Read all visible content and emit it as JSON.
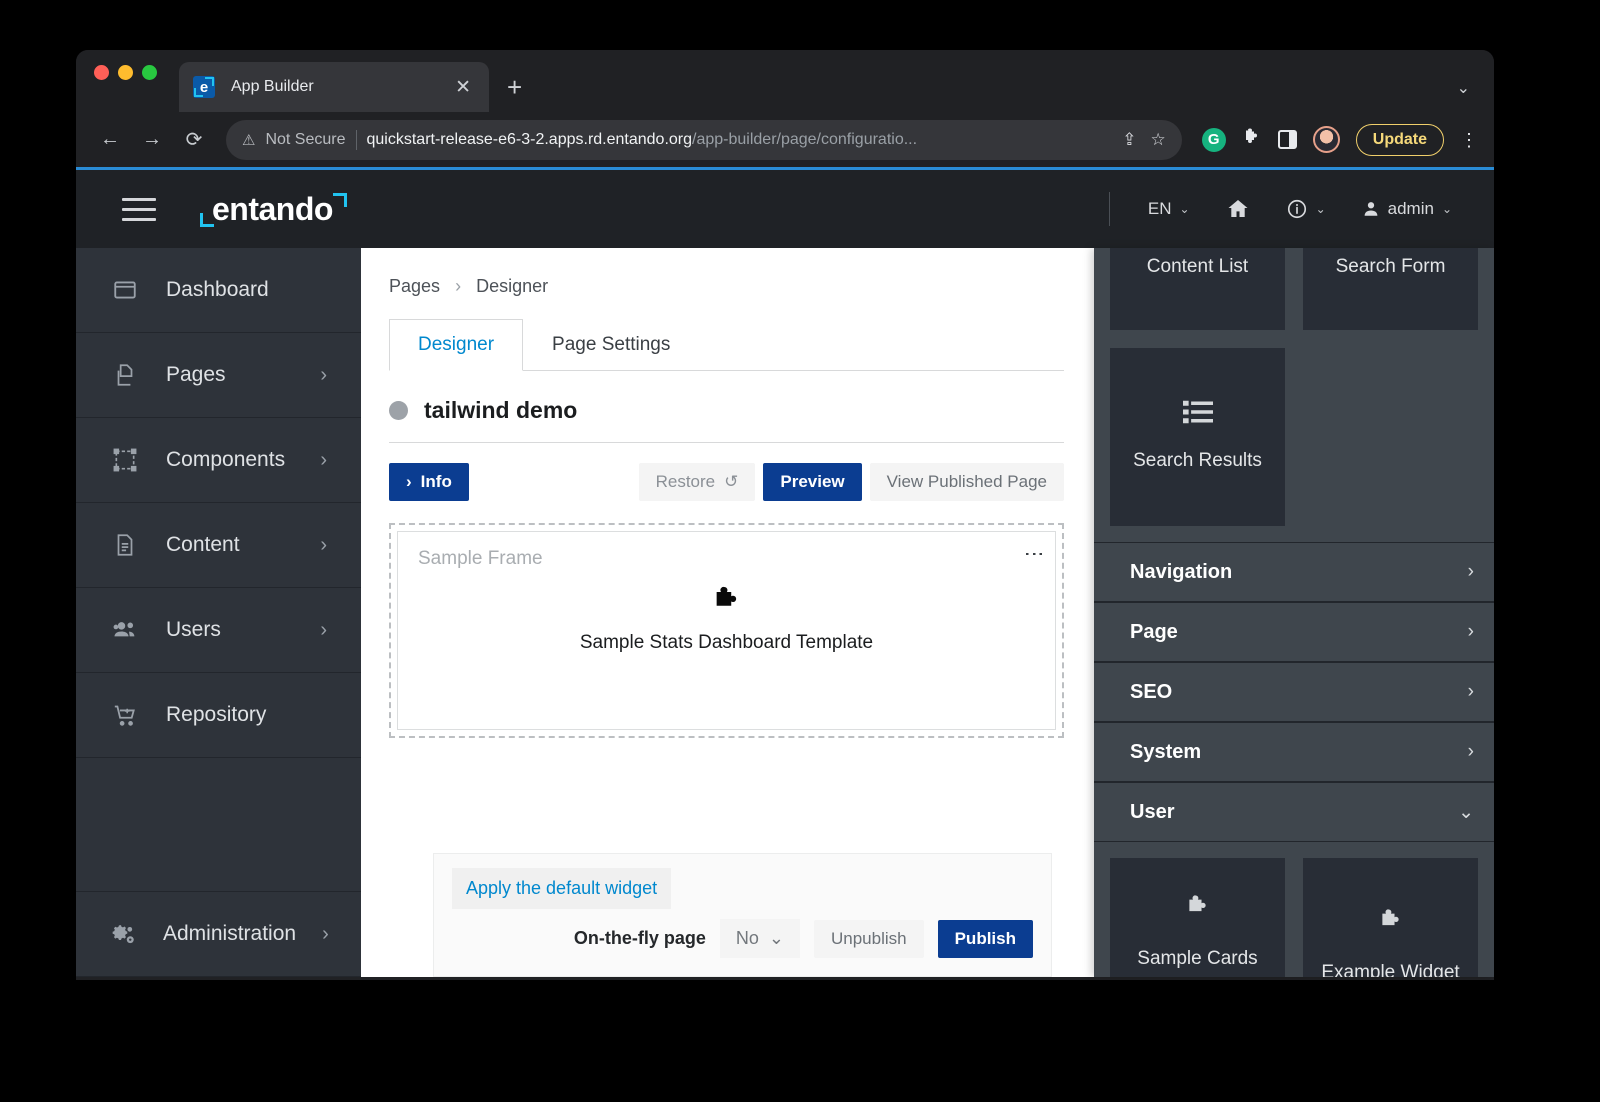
{
  "browser": {
    "tab": {
      "title": "App Builder",
      "favicon_letter": "e",
      "close_icon": "✕"
    },
    "new_tab_icon": "+",
    "tab_list_chevron": "⌄",
    "nav": {
      "back_icon": "←",
      "forward_icon": "→",
      "reload_icon": "⟳"
    },
    "omnibox": {
      "warning_icon": "⚠",
      "security_label": "Not Secure",
      "url_host": "quickstart-release-e6-3-2.apps.rd.entando.org",
      "url_path": "/app-builder/page/configuratio...",
      "share_icon": "⇪",
      "bookmark_icon": "☆"
    },
    "extensions": {
      "grammarly_icon": "G",
      "puzzle_icon": "🧩",
      "side_panel_icon": "panel",
      "avatar_icon": "avatar",
      "update_label": "Update",
      "menu_icon": "⋮"
    }
  },
  "app_header": {
    "menu_icon": "hamburger",
    "brand": "entando",
    "language": "EN",
    "home_icon": "🏠",
    "info_icon": "ⓘ",
    "user_icon": "👤",
    "user_name": "admin",
    "chevron": "⌄"
  },
  "sidebar": {
    "items": [
      {
        "label": "Dashboard",
        "icon": "dashboard-icon",
        "glyph": "▭",
        "has_arrow": false
      },
      {
        "label": "Pages",
        "icon": "pages-icon",
        "glyph": "❐",
        "has_arrow": true
      },
      {
        "label": "Components",
        "icon": "components-icon",
        "glyph": "⬚",
        "has_arrow": true
      },
      {
        "label": "Content",
        "icon": "content-icon",
        "glyph": "🗎",
        "has_arrow": true
      },
      {
        "label": "Users",
        "icon": "users-icon",
        "glyph": "👥",
        "has_arrow": true
      },
      {
        "label": "Repository",
        "icon": "repository-icon",
        "glyph": "🛒",
        "has_arrow": false
      },
      {
        "label": "Administration",
        "icon": "administration-icon",
        "glyph": "⚙",
        "has_arrow": true
      }
    ],
    "arrow_glyph": "›"
  },
  "main": {
    "breadcrumb": {
      "root": "Pages",
      "separator": "›",
      "current": "Designer"
    },
    "tabs": [
      {
        "label": "Designer",
        "active": true
      },
      {
        "label": "Page Settings",
        "active": false
      }
    ],
    "page_title": "tailwind demo",
    "actions": {
      "info_label": "Info",
      "info_chevron": "›",
      "restore_label": "Restore",
      "restore_icon": "↺",
      "preview_label": "Preview",
      "view_published_label": "View Published Page"
    },
    "frame": {
      "label": "Sample Frame",
      "menu_icon": "⋮",
      "widget_icon": "puzzle-icon",
      "widget_glyph": "🧩",
      "widget_name": "Sample Stats Dashboard Template"
    },
    "publish_bar": {
      "apply_default_widget": "Apply the default widget",
      "on_the_fly_label": "On-the-fly page",
      "on_the_fly_value": "No",
      "on_the_fly_chevron": "⌄",
      "unpublish_label": "Unpublish",
      "publish_label": "Publish"
    }
  },
  "right_panel": {
    "top_tiles": [
      {
        "label": "Content List",
        "icon": "puzzle-icon",
        "glyph": ""
      },
      {
        "label": "Search Form",
        "icon": "puzzle-icon",
        "glyph": ""
      },
      {
        "label": "Search Results",
        "icon": "list-icon",
        "glyph": "☰"
      }
    ],
    "sections": [
      {
        "label": "Navigation",
        "expanded": false,
        "arrow": "›"
      },
      {
        "label": "Page",
        "expanded": false,
        "arrow": "›"
      },
      {
        "label": "SEO",
        "expanded": false,
        "arrow": "›"
      },
      {
        "label": "System",
        "expanded": false,
        "arrow": "›"
      },
      {
        "label": "User",
        "expanded": true,
        "arrow": "⌄"
      }
    ],
    "user_tiles": [
      {
        "label": "Sample Cards Section Template",
        "icon": "puzzle-icon",
        "glyph": "🧩"
      },
      {
        "label": "Example Widget",
        "icon": "puzzle-icon",
        "glyph": "🧩"
      }
    ]
  },
  "colors": {
    "accent_blue": "#0088ce",
    "primary_button": "#0b3d91",
    "brand_cyan": "#21c3f0",
    "sidebar_bg": "#2e333a",
    "right_panel_bg": "#3f464d",
    "tile_bg": "#282d36",
    "update_yellow": "#f6d97a"
  }
}
